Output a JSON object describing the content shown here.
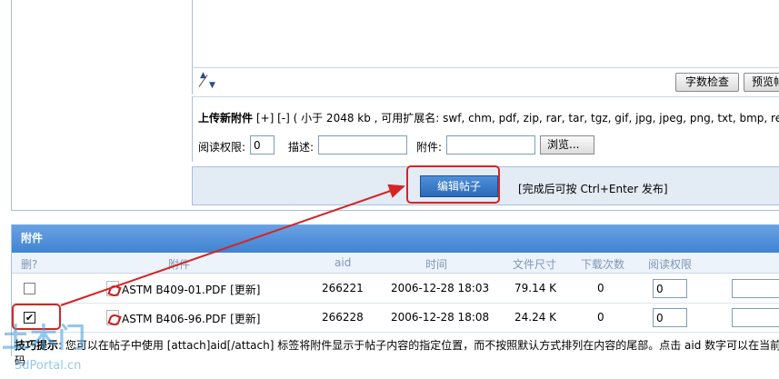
{
  "editor": {
    "wordcount_label": "字数检查",
    "preview_label": "预览帖"
  },
  "upload": {
    "title": "上传新附件",
    "expand": "[+]",
    "collapse": "[-]",
    "limit_text": "( 小于 2048 kb , 可用扩展名: swf, chm, pdf, zip, rar, tar, tgz, gif, jpg, jpeg, png, txt, bmp, rev)",
    "perm_label": "阅读权限:",
    "perm_value": "0",
    "desc_label": "描述:",
    "desc_value": "",
    "file_label": "附件:",
    "file_value": "",
    "browse_label": "浏览..."
  },
  "submit": {
    "button_label": "编辑帖子",
    "hint": "[完成后可按 Ctrl+Enter 发布]"
  },
  "attachments": {
    "header": "附件",
    "columns": {
      "delete": "删?",
      "file": "附件",
      "aid": "aid",
      "time": "时间",
      "size": "文件尺寸",
      "downloads": "下载次数",
      "perm": "阅读权限"
    },
    "rows": [
      {
        "checked": false,
        "name": "ASTM B409-01.PDF",
        "update": "[更新]",
        "aid": "266221",
        "time": "2006-12-28 18:03",
        "size": "79.14 K",
        "downloads": "0",
        "perm": "0"
      },
      {
        "checked": true,
        "name": "ASTM B406-96.PDF",
        "update": "[更新]",
        "aid": "266228",
        "time": "2006-12-28 18:08",
        "size": "24.24 K",
        "downloads": "0",
        "perm": "0"
      }
    ],
    "check_mark": "✔"
  },
  "tips": {
    "label": "技巧提示",
    "text": ": 您可以在帖子中使用 [attach]aid[/attach] 标签将附件显示于帖子内容的指定位置，而不按照默认方式排列在内容的尾部。点击 aid 数字可以在当前光标",
    "continuation": "码"
  },
  "watermark": {
    "main": "土木门",
    "sub": "3dPortal.cn"
  },
  "colors": {
    "annotation": "#d42424",
    "header_blue": "#4a8cd8",
    "submit_blue": "#2b6ab8"
  }
}
